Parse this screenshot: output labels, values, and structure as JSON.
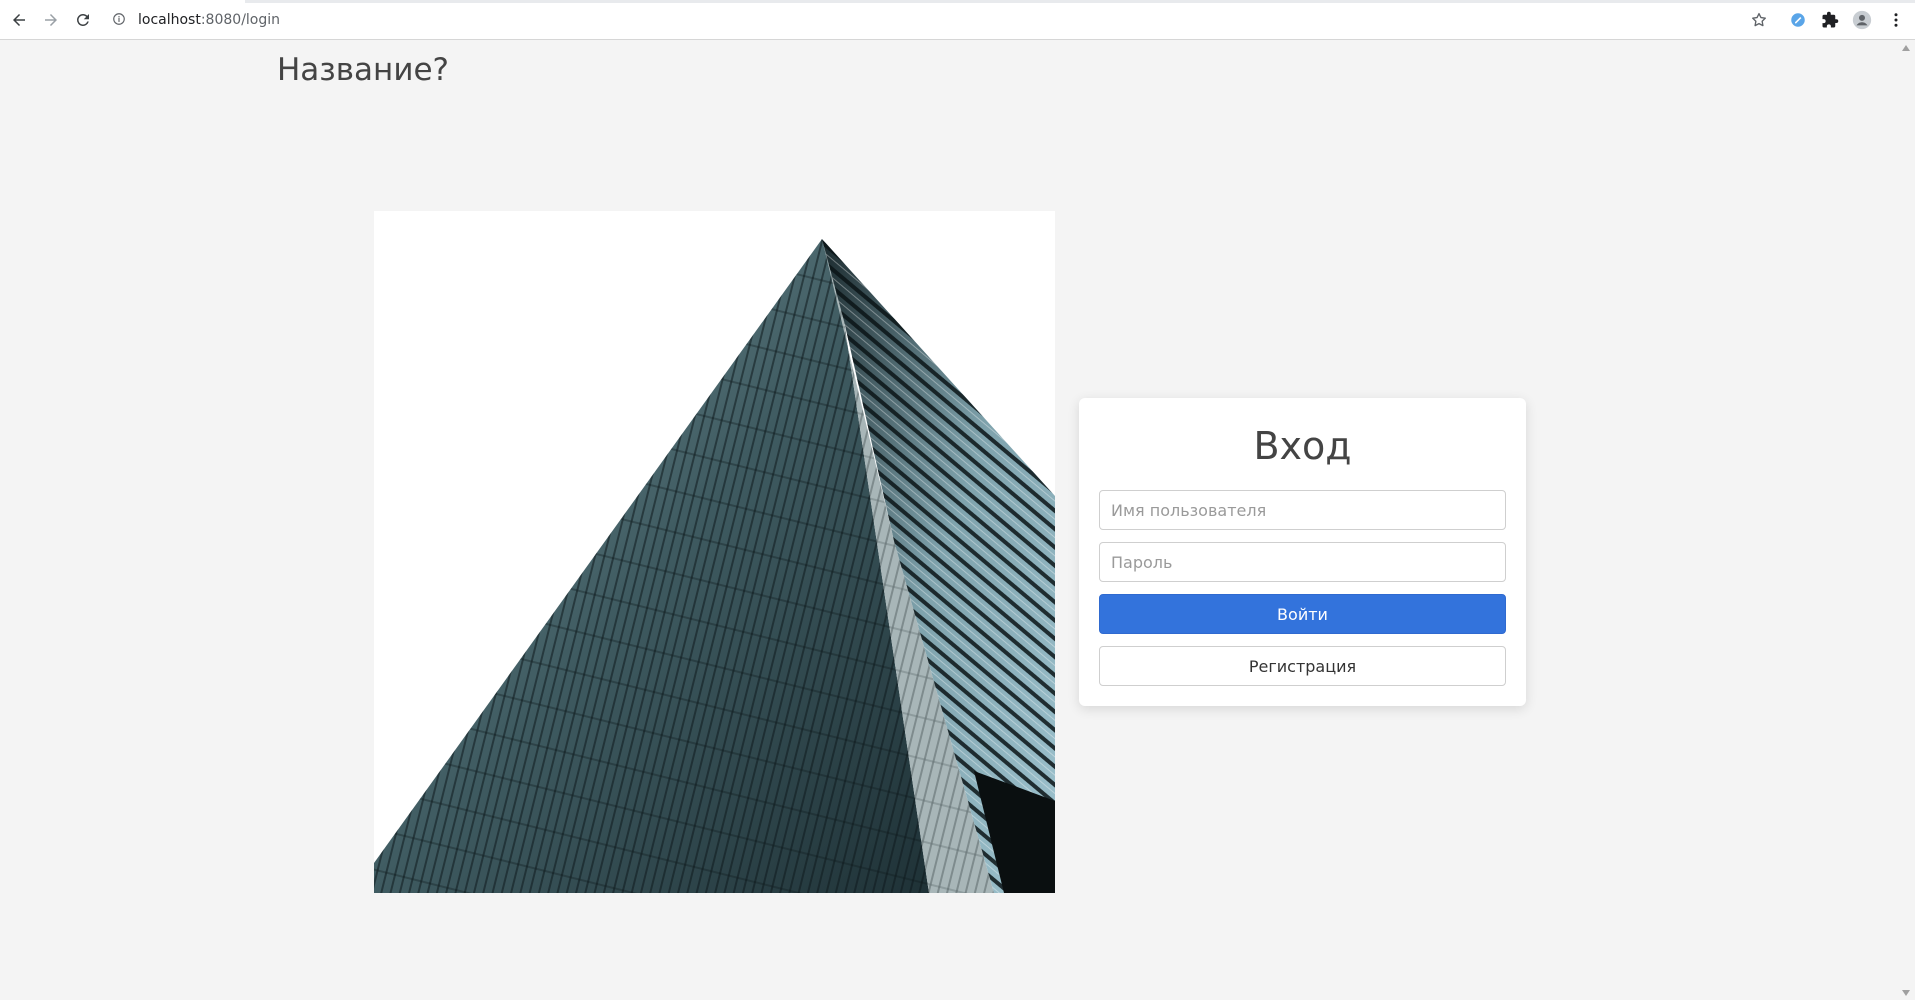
{
  "browser": {
    "url_host": "localhost",
    "url_rest": ":8080/login"
  },
  "page": {
    "title": "Название?"
  },
  "login": {
    "title": "Вход",
    "username_placeholder": "Имя пользователя",
    "password_placeholder": "Пароль",
    "login_button": "Войти",
    "register_button": "Регистрация"
  },
  "colors": {
    "primary": "#3373dc",
    "background": "#f4f4f4"
  },
  "icons": {
    "back": "back-arrow-icon",
    "forward": "forward-arrow-icon",
    "reload": "reload-icon",
    "info": "info-icon",
    "bookmark": "star-icon",
    "extension_app": "extension-app-icon",
    "extensions": "puzzle-icon",
    "profile": "profile-icon",
    "menu": "kebab-menu-icon"
  }
}
